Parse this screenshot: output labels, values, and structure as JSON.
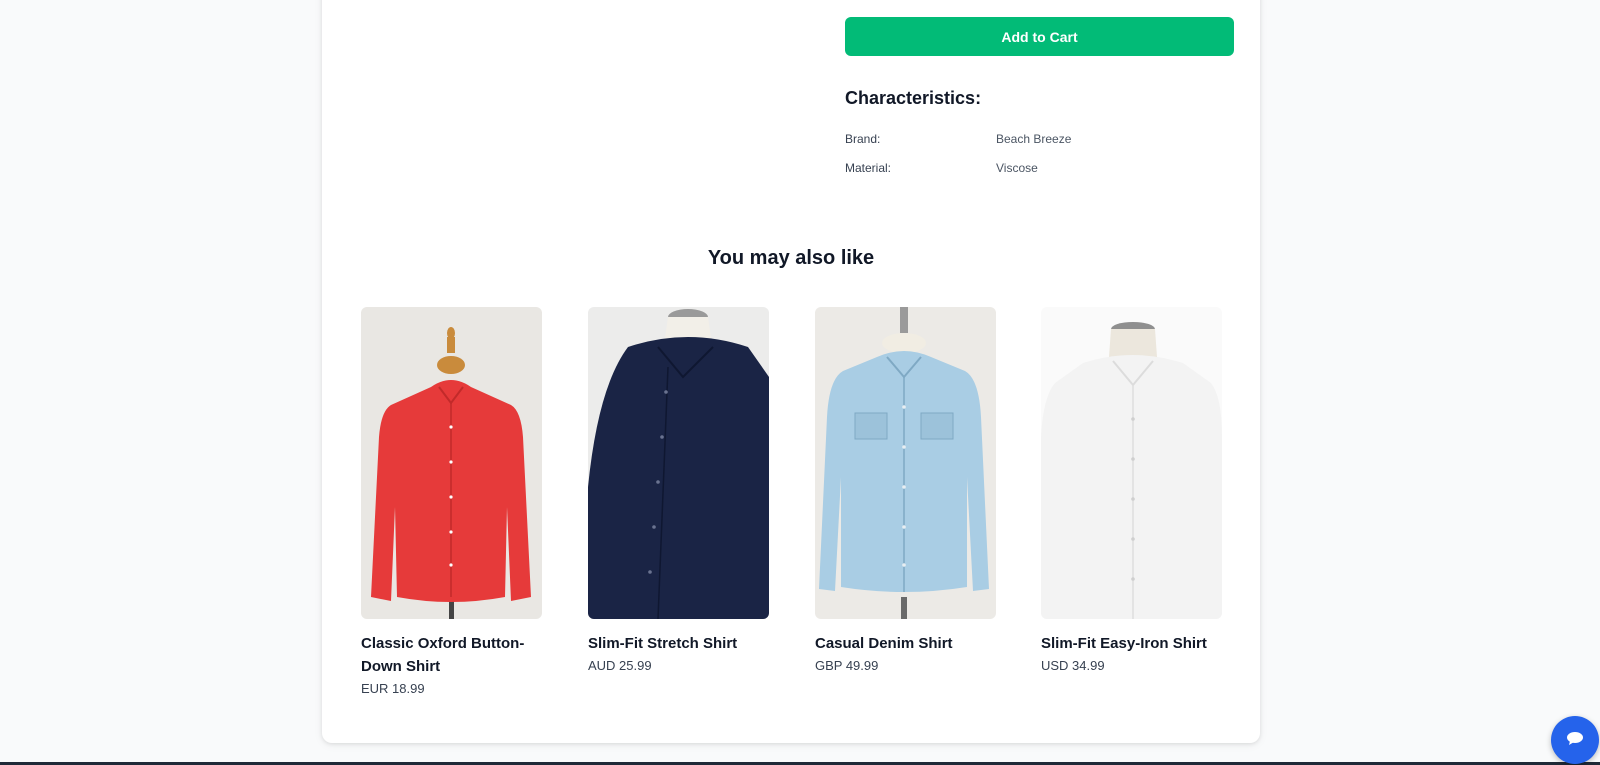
{
  "actions": {
    "add_to_cart_label": "Add to Cart"
  },
  "characteristics": {
    "title": "Characteristics:",
    "rows": [
      {
        "label": "Brand:",
        "value": "Beach Breeze"
      },
      {
        "label": "Material:",
        "value": "Viscose"
      }
    ]
  },
  "recommendations": {
    "title": "You may also like",
    "items": [
      {
        "name": "Classic Oxford Button-Down Shirt",
        "price": "EUR 18.99",
        "image": "red-shirt-on-mannequin",
        "color": "#e63a3a"
      },
      {
        "name": "Slim-Fit Stretch Shirt",
        "price": "AUD 25.99",
        "image": "navy-shirt-on-mannequin",
        "color": "#1a2445"
      },
      {
        "name": "Casual Denim Shirt",
        "price": "GBP 49.99",
        "image": "light-blue-denim-shirt-on-mannequin",
        "color": "#a9cde4"
      },
      {
        "name": "Slim-Fit Easy-Iron Shirt",
        "price": "USD 34.99",
        "image": "white-shirt-on-mannequin",
        "color": "#f6f6f6"
      }
    ]
  },
  "chat": {
    "icon": "chat-bubble-icon"
  },
  "colors": {
    "accent": "#02bb77",
    "chat_button": "#2563eb"
  }
}
